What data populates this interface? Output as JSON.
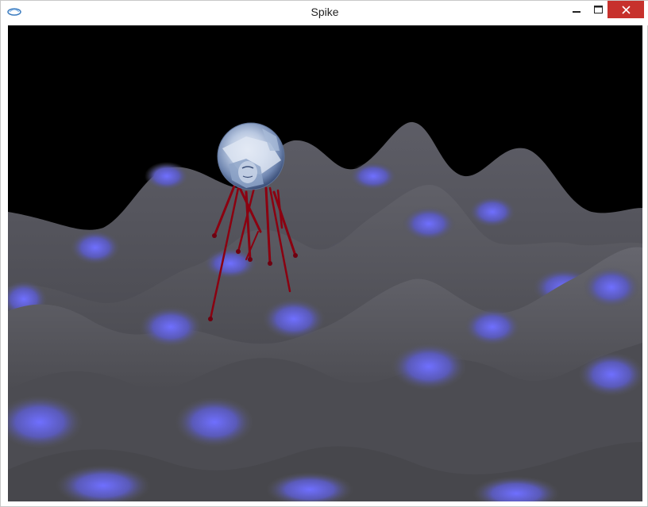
{
  "window": {
    "title": "Spike"
  },
  "titlebar": {
    "app_icon": "opengl-swirl-icon",
    "minimize_icon": "minimize-icon",
    "maximize_icon": "maximize-icon",
    "close_icon": "close-icon"
  },
  "colors": {
    "close_button": "#c7312c",
    "terrain_gray": "#555559",
    "terrain_highlight": "#6b6bff",
    "spike_red": "#8b0010",
    "background": "#000000"
  }
}
